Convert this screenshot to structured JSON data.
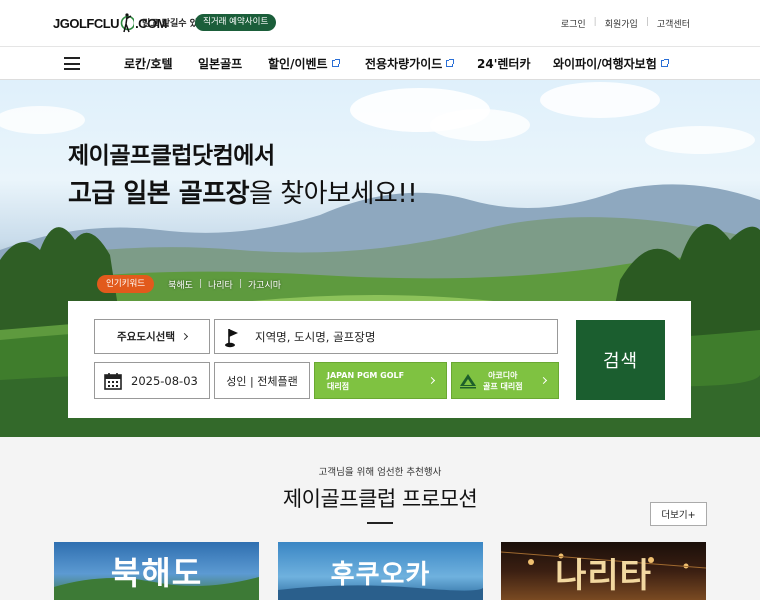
{
  "header": {
    "logo_text": "JGOLFCLUB.COM",
    "logo_left": "JGOLFCLU",
    "logo_right": ".COM",
    "tagline": "믿고 맡길수 있는",
    "badge": "직거래 예약사이트",
    "links": [
      "로그인",
      "회원가입",
      "고객센터"
    ]
  },
  "nav": {
    "menu_icon": "hamburger-icon",
    "items": [
      {
        "label": "로칸/호텔",
        "external": false
      },
      {
        "label": "일본골프",
        "external": false
      },
      {
        "label": "할인/이벤트",
        "external": true
      },
      {
        "label": "전용차량가이드",
        "external": true
      },
      {
        "label": "24'렌터카",
        "external": false
      },
      {
        "label": "와이파이/여행자보험",
        "external": true
      }
    ]
  },
  "hero": {
    "line1": "제이골프클럽닷컴에서",
    "line2_bold": "고급 일본 골프장",
    "line2_rest": "을 찾아보세요!!",
    "keyword_badge": "인기키워드",
    "keywords": [
      "북해도",
      "나리타",
      "가고시마"
    ]
  },
  "search": {
    "city_select": "주요도시선택",
    "keyword_placeholder": "지역명, 도시명, 골프장명",
    "date": "2025-08-03",
    "plan": "성인 | 전체플랜",
    "agent1_line1": "JAPAN PGM GOLF",
    "agent1_line2": "대리점",
    "agent2_line1": "아코디아",
    "agent2_line2": "골프 대리점",
    "button": "검색",
    "accent": "#1b5e2f"
  },
  "promo": {
    "subtitle": "고객님을 위해 엄선한 추천행사",
    "title": "제이골프클럽 프로모션",
    "more": "더보기+",
    "cards": [
      "북해도",
      "후쿠오카",
      "나리타"
    ]
  }
}
